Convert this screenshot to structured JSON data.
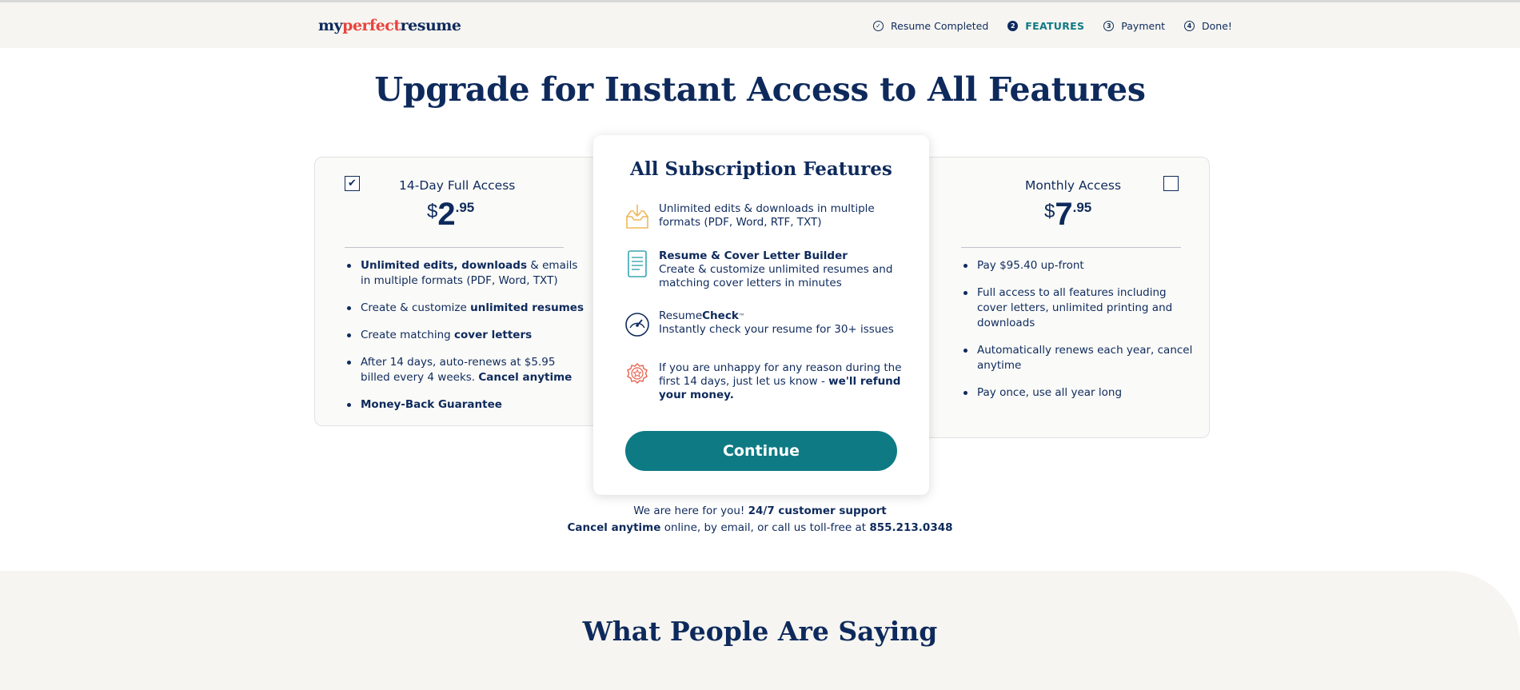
{
  "header": {
    "logo": {
      "part1": "my",
      "part2": "perfect",
      "part3": "resume"
    },
    "steps": [
      {
        "icon": "✓",
        "label": "Resume Completed",
        "state": "completed"
      },
      {
        "icon": "2",
        "label": "FEATURES",
        "state": "active"
      },
      {
        "icon": "3",
        "label": "Payment",
        "state": "upcoming"
      },
      {
        "icon": "4",
        "label": "Done!",
        "state": "upcoming"
      }
    ]
  },
  "headline": "Upgrade for Instant Access to All Features",
  "plans": {
    "left": {
      "checked": true,
      "check_glyph": "✔",
      "title": "14-Day Full Access",
      "price": {
        "currency": "$",
        "dollars": "2",
        "cents": ".95"
      },
      "items": [
        {
          "bold": "Unlimited edits, downloads",
          "after": " & emails in multiple formats (PDF, Word, TXT)"
        },
        {
          "before": "Create & customize ",
          "bold": "unlimited resumes"
        },
        {
          "before": "Create matching ",
          "bold": "cover letters"
        },
        {
          "before": "After 14 days, auto-renews at $5.95 billed every 4 weeks. ",
          "bold": "Cancel anytime"
        },
        {
          "bold": "Money-Back Guarantee"
        }
      ]
    },
    "right": {
      "checked": false,
      "title": "Monthly Access",
      "price": {
        "currency": "$",
        "dollars": "7",
        "cents": ".95"
      },
      "items": [
        "Pay $95.40 up-front",
        "Full access to all features including cover letters, unlimited printing and downloads",
        "Automatically renews each year, cancel anytime",
        "Pay once, use all year long"
      ]
    }
  },
  "features_card": {
    "title": "All Subscription Features",
    "features": [
      {
        "icon": "download-tray-icon",
        "text": "Unlimited edits & downloads in multiple formats (PDF, Word, RTF, TXT)"
      },
      {
        "icon": "document-icon",
        "heading": "Resume & Cover Letter Builder",
        "text": "Create & customize unlimited resumes and matching cover letters in minutes"
      },
      {
        "icon": "gauge-icon",
        "heading_plain": "Resume",
        "heading_bold": "Check",
        "heading_tm": "™",
        "text": "Instantly check your resume for 30+ issues"
      },
      {
        "icon": "badge-star-icon",
        "text": "If you are unhappy for any reason during the first 14 days, just let us know - ",
        "text_bold": "we'll refund your money."
      }
    ],
    "continue_label": "Continue"
  },
  "support": {
    "line1_plain": "We are here for you! ",
    "line1_bold": "24/7 customer support",
    "line2_bold": "Cancel anytime",
    "line2_plain": " online, by email, or call us toll-free at ",
    "phone": "855.213.0348"
  },
  "testimonials_title": "What People Are Saying",
  "colors": {
    "navy": "#0e2a5c",
    "teal": "#0e7a84",
    "logo_red": "#e8433c",
    "header_bg": "#f6f5f1",
    "icon_orange": "#f0b75a",
    "icon_teal": "#3aa5b0",
    "icon_red": "#e8604c"
  }
}
